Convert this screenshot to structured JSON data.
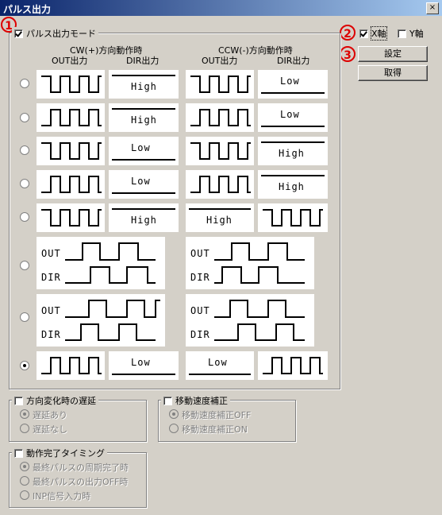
{
  "window": {
    "title": "パルス出力",
    "close_label": "×"
  },
  "annotations": {
    "a1": "1",
    "a2": "2",
    "a3": "3"
  },
  "pulse_mode": {
    "label": "パルス出力モード",
    "checked": true,
    "cw_header": "CW(+)方向動作時",
    "ccw_header": "CCW(-)方向動作時",
    "out_label": "OUT出力",
    "dir_label": "DIR出力",
    "selected_row": 8,
    "rows": [
      {
        "cw_dir": "High",
        "ccw_dir": "Low"
      },
      {
        "cw_dir": "High",
        "ccw_dir": "Low"
      },
      {
        "cw_dir": "Low",
        "ccw_dir": "High"
      },
      {
        "cw_dir": "Low",
        "ccw_dir": "High"
      },
      {
        "cw_dir": "High",
        "ccw_out": "High"
      },
      {
        "cw_out": "OUT",
        "cw_dir": "DIR",
        "ccw_out": "OUT",
        "ccw_dir": "DIR"
      },
      {
        "cw_out": "OUT",
        "cw_dir": "DIR",
        "ccw_out": "OUT",
        "ccw_dir": "DIR"
      },
      {
        "cw_dir": "Low",
        "ccw_out": "Low"
      }
    ]
  },
  "axis": {
    "x_label": "X軸",
    "x_checked": true,
    "y_label": "Y軸",
    "y_checked": false
  },
  "buttons": {
    "set": "設定",
    "get": "取得"
  },
  "direction_delay": {
    "label": "方向変化時の遅延",
    "checked": false,
    "options": [
      "遅延あり",
      "遅延なし"
    ],
    "selected": 0
  },
  "speed_comp": {
    "label": "移動速度補正",
    "checked": false,
    "options": [
      "移動速度補正OFF",
      "移動速度補正ON"
    ],
    "selected": 0
  },
  "completion_timing": {
    "label": "動作完了タイミング",
    "checked": false,
    "options": [
      "最終パルスの周期完了時",
      "最終パルスの出力OFF時",
      "INP信号入力時"
    ],
    "selected": 0
  }
}
